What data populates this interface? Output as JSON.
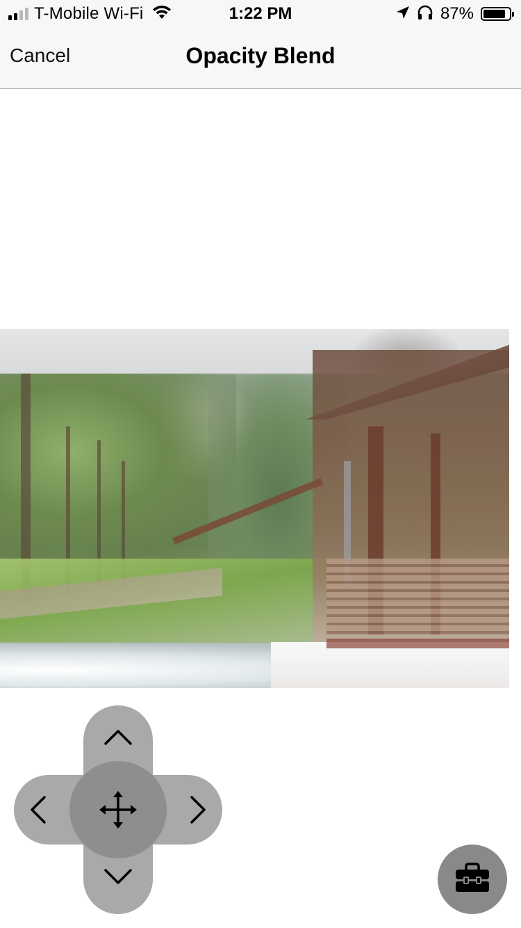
{
  "status_bar": {
    "carrier": "T-Mobile Wi-Fi",
    "time": "1:22 PM",
    "battery_percent": "87%",
    "battery_level": 0.87,
    "icons": [
      "signal-bars-icon",
      "wifi-icon",
      "location-arrow-icon",
      "headphones-icon",
      "battery-icon"
    ]
  },
  "nav": {
    "cancel_label": "Cancel",
    "title": "Opacity Blend"
  },
  "canvas": {
    "content": "blended-photo"
  },
  "controls": {
    "dpad_icons": [
      "chevron-up-icon",
      "chevron-down-icon",
      "chevron-left-icon",
      "chevron-right-icon",
      "move-arrows-icon"
    ],
    "toolbox_icon": "toolbox-icon"
  },
  "colors": {
    "bar_background": "#f7f7f7",
    "dpad_arm": "#a9a9a9",
    "dpad_center": "#8e8e8e",
    "toolbox_button": "#898989"
  }
}
